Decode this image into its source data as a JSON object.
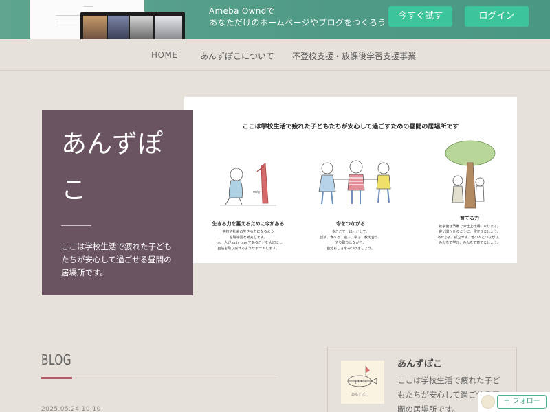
{
  "promo": {
    "line1": "Ameba Owndで",
    "line2": "あなただけのホームページやブログをつくろう",
    "try_label": "今すぐ試す",
    "login_label": "ログイン"
  },
  "nav": {
    "items": [
      {
        "label": "HOME"
      },
      {
        "label": "あんずぽこについて"
      },
      {
        "label": "不登校支援・放課後学習支援事業"
      }
    ]
  },
  "hero": {
    "caption": "ここは学校生活で疲れた子どもたちが安心して過ごすための昼間の居場所です",
    "columns": [
      {
        "heading": "生きる力を蓄えるために今がある",
        "lines": [
          "学校や社会の生きる力になるよう",
          "基礎学習を補充します。",
          "一人一人が only one であることを大切にし",
          "自信を取り戻せるようサポートします。"
        ]
      },
      {
        "heading": "今をつながる",
        "lines": [
          "今ここで、ほっとして、",
          "話す、食べる、遊ぶ、学ぶ、教え合う。",
          "やり取りしながら、",
          "自分らしさをみつけましょう。"
        ]
      },
      {
        "heading": "育てる力",
        "lines": [
          "就学後は予備での仕上げ期になります。",
          "良い聞かせるように、見守りましょう。",
          "あせらず、孤立せず、他の人とつながり、",
          "みんなで学び、みんなで育てましょう。"
        ]
      }
    ]
  },
  "title_card": {
    "title": "あんずぽこ",
    "description": "ここは学校生活で疲れた子どもたちが安心して過ごせる昼間の居場所です。"
  },
  "blog": {
    "heading": "BLOG",
    "date": "2025.05.24 10:10"
  },
  "profile": {
    "name": "あんずぽこ",
    "description": "ここは学校生活で疲れた子どもたちが安心して過ごせる昼間の居場所です。",
    "logo_text": "poco",
    "logo_subtext": "あんずぽこ"
  },
  "follow": {
    "label": "＋ フォロー"
  },
  "colors": {
    "promo_bg": "#4f9a86",
    "promo_button": "#3cc49a",
    "card_bg": "#6b5461",
    "accent": "#b65b6a",
    "page_bg": "#e6e1da"
  }
}
